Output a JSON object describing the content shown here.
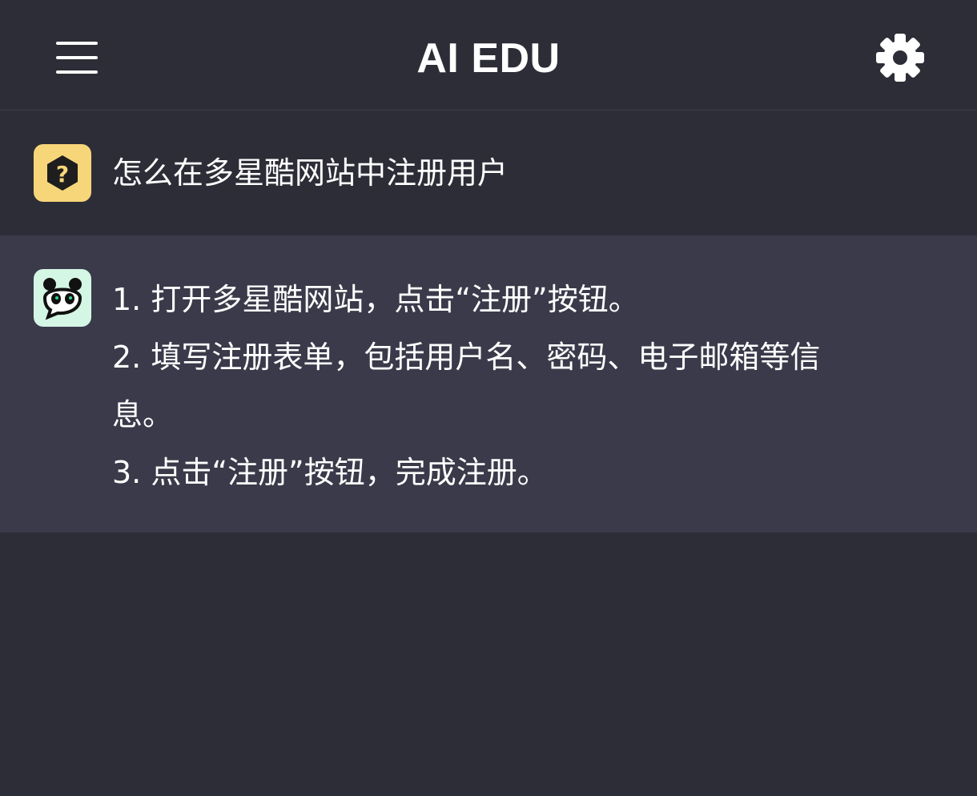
{
  "header": {
    "title": "AI EDU",
    "menu_icon": "hamburger-menu-icon",
    "settings_icon": "gear-icon"
  },
  "question": {
    "avatar_icon": "question-hexagon-icon",
    "text": "怎么在多星酷网站中注册用户"
  },
  "answer": {
    "avatar_icon": "panda-bot-icon",
    "lines": [
      "1. 打开多星酷网站，点击“注册”按钮。",
      "2. 填写注册表单，包括用户名、密码、电子邮箱等信",
      "息。",
      "3. 点击“注册”按钮，完成注册。"
    ]
  },
  "colors": {
    "background": "#2d2d37",
    "answer_background": "#3a3a4a",
    "user_avatar_bg": "#f7d67a",
    "bot_avatar_bg": "#d4f6e4",
    "text": "#ffffff"
  }
}
